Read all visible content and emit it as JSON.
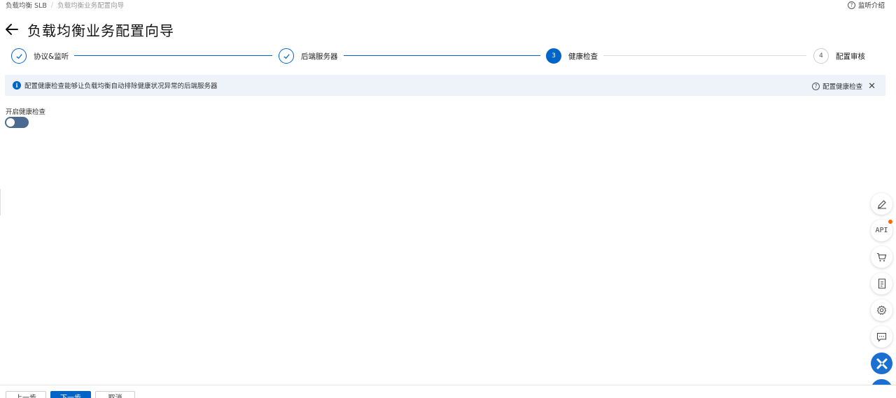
{
  "breadcrumb": {
    "root": "负载均衡 SLB",
    "separator": "/",
    "current": "负载均衡业务配置向导"
  },
  "help": {
    "label": "监听介绍",
    "icon": "question-circle-icon"
  },
  "header": {
    "title": "负载均衡业务配置向导",
    "back_icon": "arrow-left-icon"
  },
  "steps": [
    {
      "label": "协议&监听",
      "state": "done"
    },
    {
      "label": "后端服务器",
      "state": "done"
    },
    {
      "label": "健康检查",
      "number": "3",
      "state": "active"
    },
    {
      "label": "配置审核",
      "number": "4",
      "state": "pending"
    }
  ],
  "notice": {
    "text": "配置健康检查能够让负载均衡自动排除健康状况异常的后端服务器",
    "link": "配置健康检查",
    "close_icon": "close-icon"
  },
  "health_check": {
    "label": "开启健康检查",
    "enabled": false
  },
  "footer": {
    "prev": "上一步",
    "next": "下一步",
    "cancel": "取消"
  },
  "tools": [
    "edit-icon",
    "api-icon",
    "cart-icon",
    "doc-icon",
    "gear-icon",
    "message-icon",
    "assistant-icon",
    "apps-icon"
  ],
  "tool_labels": {
    "api": "API"
  },
  "colors": {
    "accent": "#0064c8",
    "notice_bg": "#eef3fa",
    "toggle_off": "#4a6b8f",
    "badge": "#ff6a00"
  }
}
